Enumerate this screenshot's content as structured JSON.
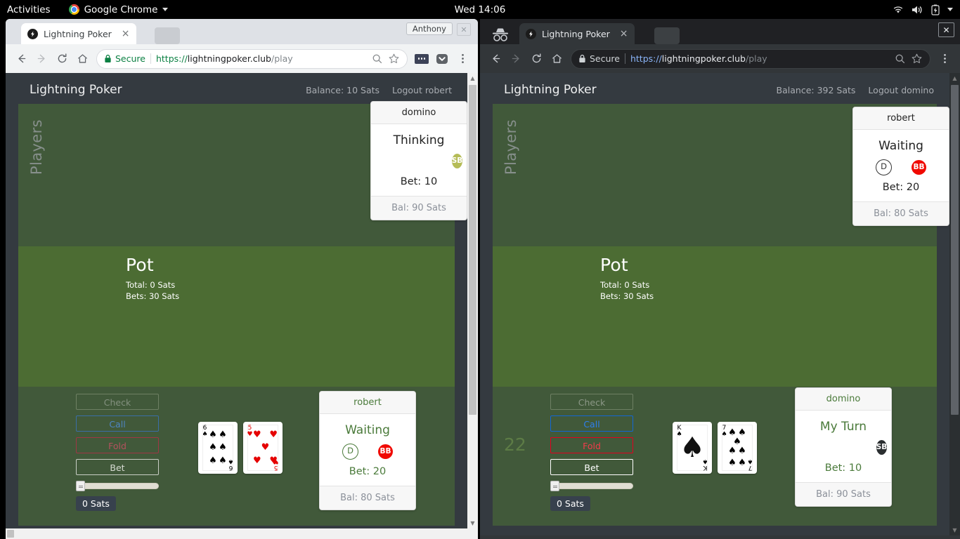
{
  "system": {
    "activities": "Activities",
    "app_menu": "Google Chrome",
    "clock": "Wed 14:06",
    "tray_icons": [
      "wifi-icon",
      "volume-icon",
      "battery-icon",
      "caret-down-icon"
    ]
  },
  "windows": [
    {
      "id": "left",
      "mode": "normal",
      "profile_chip": "Anthony",
      "tab": {
        "title": "Lightning Poker",
        "close": "×"
      },
      "omnibox": {
        "secure_label": "Secure",
        "scheme": "https://",
        "host": "lightningpoker.club",
        "path": "/play"
      },
      "toolbar_icons": [
        "back-icon",
        "forward-icon",
        "reload-icon",
        "home-icon",
        "zoom-icon",
        "bookmark-star-icon",
        "extension-icon",
        "pocket-icon",
        "menu-icon"
      ],
      "app": {
        "title": "Lightning Poker",
        "balance": "Balance: 10 Sats",
        "logout": "Logout robert",
        "players_label": "Players",
        "pot": {
          "title": "Pot",
          "total": "Total: 0 Sats",
          "bets": "Bets: 30 Sats"
        },
        "opponent": {
          "name": "domino",
          "state": "Thinking",
          "badges": [
            "SB"
          ],
          "bet": "Bet: 10",
          "balance": "Bal: 90 Sats"
        },
        "self": {
          "name": "robert",
          "state": "Waiting",
          "badges": [
            "D",
            "BB"
          ],
          "bet": "Bet: 20",
          "balance": "Bal: 80 Sats"
        },
        "actions": {
          "check": "Check",
          "call": "Call",
          "fold": "Fold",
          "bet": "Bet",
          "slider_value": "0 Sats",
          "active": false
        },
        "hand": [
          {
            "rank": "6",
            "suit": "spades",
            "color": "black"
          },
          {
            "rank": "5",
            "suit": "hearts",
            "color": "red"
          }
        ],
        "ghost_number": ""
      }
    },
    {
      "id": "right",
      "mode": "incognito",
      "profile_chip": "",
      "tab": {
        "title": "Lightning Poker",
        "close": "×"
      },
      "omnibox": {
        "secure_label": "Secure",
        "scheme": "https://",
        "host": "lightningpoker.club",
        "path": "/play"
      },
      "toolbar_icons": [
        "back-icon",
        "forward-icon",
        "reload-icon",
        "home-icon",
        "zoom-icon",
        "bookmark-star-icon",
        "menu-icon"
      ],
      "app": {
        "title": "Lightning Poker",
        "balance": "Balance: 392 Sats",
        "logout": "Logout domino",
        "players_label": "Players",
        "pot": {
          "title": "Pot",
          "total": "Total: 0 Sats",
          "bets": "Bets: 30 Sats"
        },
        "opponent": {
          "name": "robert",
          "state": "Waiting",
          "badges": [
            "D",
            "BB"
          ],
          "bet": "Bet: 20",
          "balance": "Bal: 80 Sats"
        },
        "self": {
          "name": "domino",
          "state": "My Turn",
          "badges": [
            "SB"
          ],
          "bet": "Bet: 10",
          "balance": "Bal: 90 Sats"
        },
        "actions": {
          "check": "Check",
          "call": "Call",
          "fold": "Fold",
          "bet": "Bet",
          "slider_value": "0 Sats",
          "active": true
        },
        "hand": [
          {
            "rank": "K",
            "suit": "spades",
            "color": "black"
          },
          {
            "rank": "7",
            "suit": "spades",
            "color": "black"
          }
        ],
        "ghost_number": "22"
      }
    }
  ],
  "colors": {
    "table_dark_green": "#41593a",
    "table_light_green": "#4c6c33",
    "app_background": "#343a40",
    "sb_badge": "#b5bc57",
    "bb_badge": "#f00900",
    "self_text_green": "#4a7a3a",
    "secure_green": "#0b8043"
  }
}
